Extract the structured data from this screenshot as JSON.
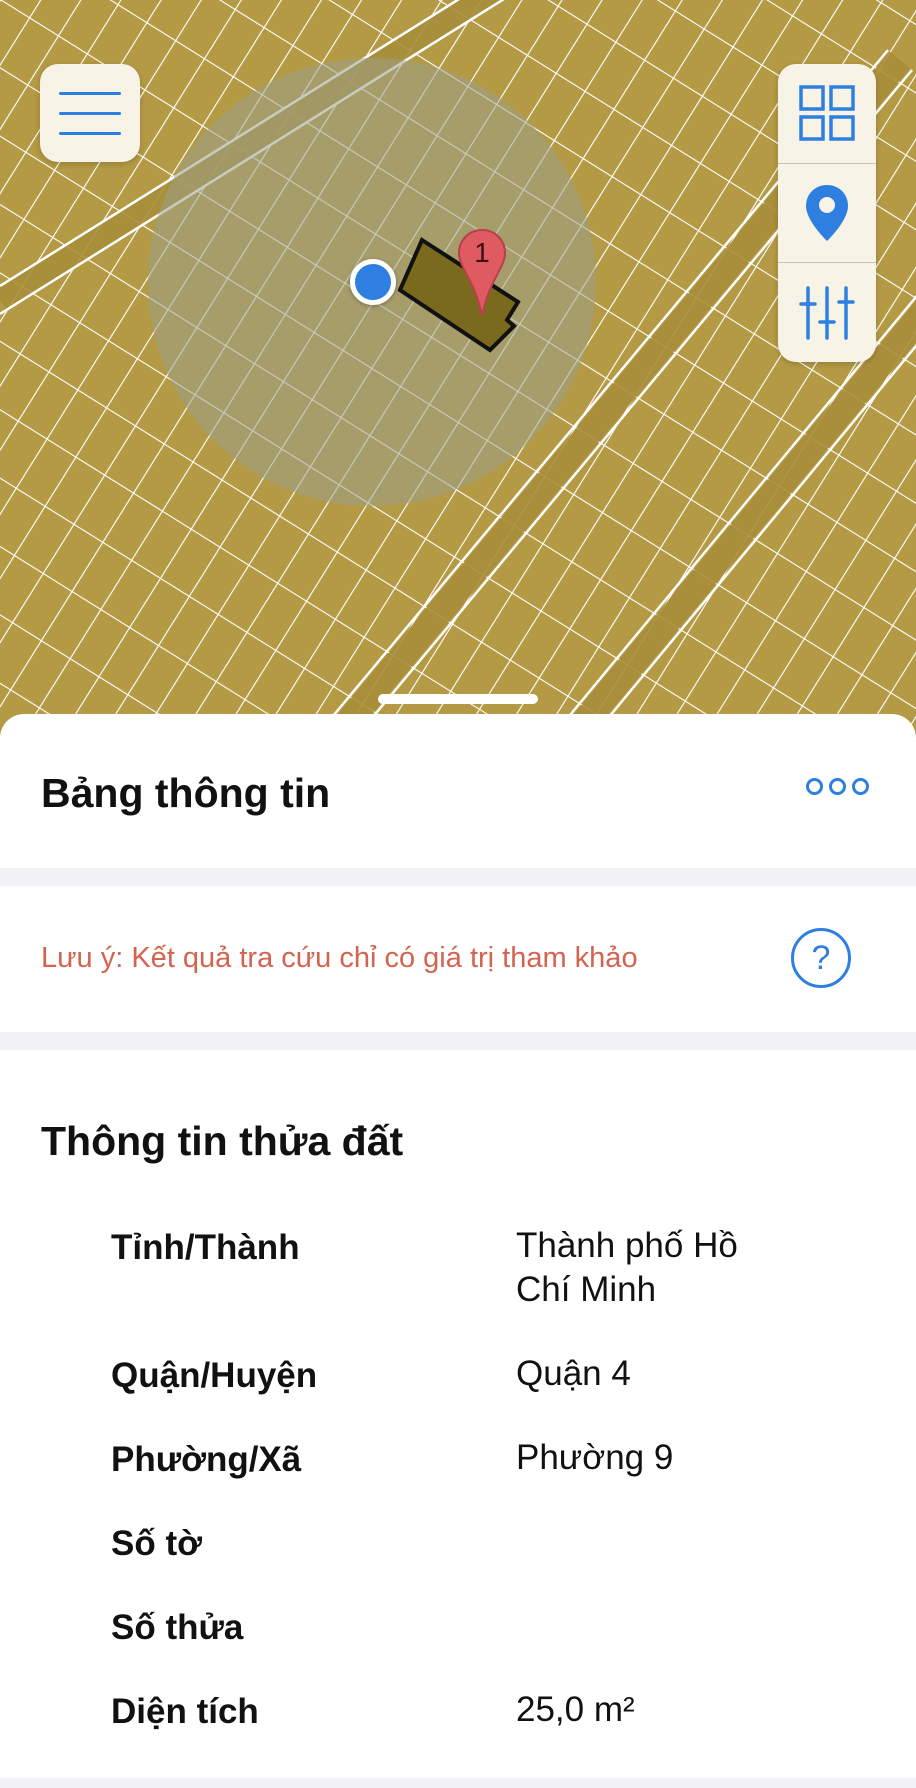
{
  "map": {
    "marker_label": "1",
    "colors": {
      "land": "#b49a44",
      "parcel_line": "#ffffff",
      "highlight": "#7a6a1e",
      "radius_fill": "#9aa08a",
      "accent": "#2f7fe0",
      "marker": "#e05a62"
    },
    "icons": {
      "menu": "hamburger-icon",
      "layers": "grid-icon",
      "location": "location-pin-icon",
      "filters": "sliders-icon"
    }
  },
  "sheet": {
    "title": "Bảng thông tin",
    "more_icon": "more-dots-icon"
  },
  "notice": {
    "text": "Lưu ý: Kết quả tra cứu chỉ có giá trị tham khảo",
    "help_symbol": "?"
  },
  "parcel": {
    "title": "Thông tin thửa đất",
    "rows": [
      {
        "label": "Tỉnh/Thành",
        "value": "Thành phố Hồ Chí Minh"
      },
      {
        "label": "Quận/Huyện",
        "value": "Quận 4"
      },
      {
        "label": "Phường/Xã",
        "value": "Phường 9"
      },
      {
        "label": "Số tờ",
        "value": ""
      },
      {
        "label": "Số thửa",
        "value": ""
      },
      {
        "label": "Diện tích",
        "value": "25,0 m²"
      }
    ]
  }
}
